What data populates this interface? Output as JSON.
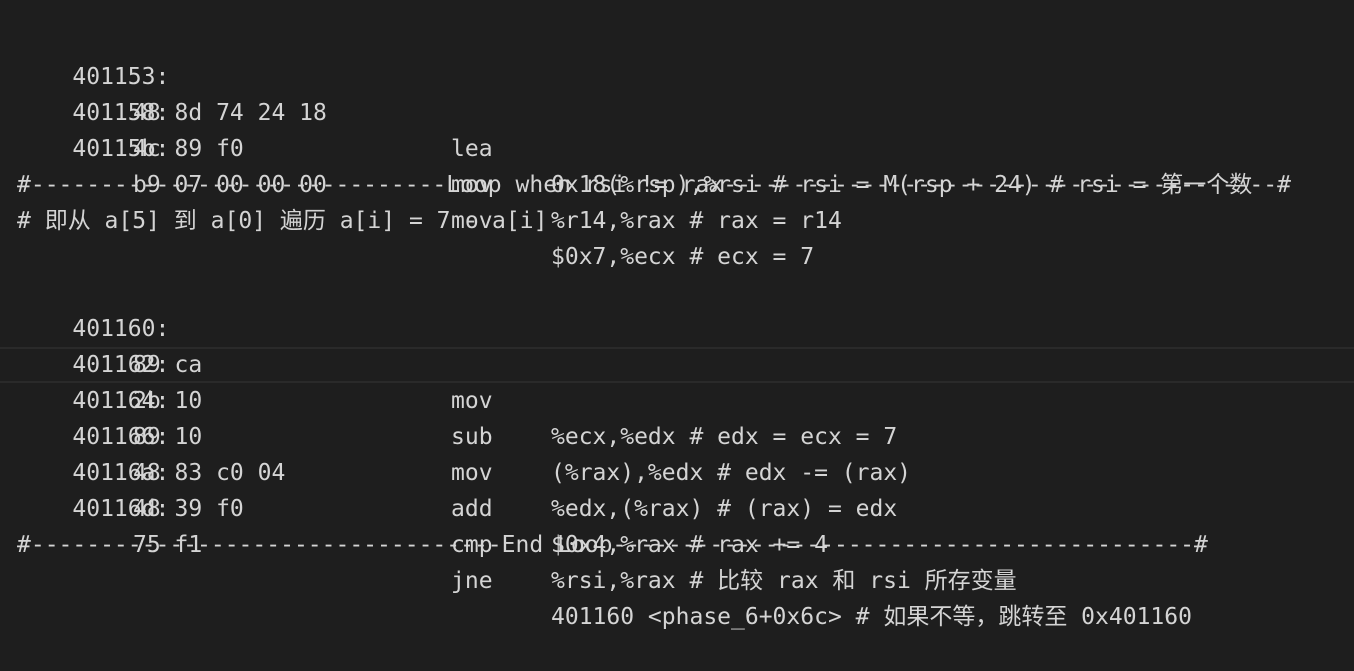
{
  "lines": [
    {
      "addr": "401153:",
      "bytes": "48 8d 74 24 18",
      "mnemonic": "lea",
      "operands": "0x18(%rsp),%rsi # rsi = M(rsp + 24) # rsi = 第一个数"
    },
    {
      "addr": "401158:",
      "bytes": "4c 89 f0",
      "mnemonic": "mov",
      "operands": "%r14,%rax # rax = r14"
    },
    {
      "addr": "40115b:",
      "bytes": "b9 07 00 00 00",
      "mnemonic": "mov",
      "operands": "$0x7,%ecx # ecx = 7"
    }
  ],
  "loop_header": "#------------------------------Loop when rsi != rax----------------------------------------#",
  "loop_comment": "# 即从 a[5] 到 a[0] 遍历 a[i] = 7 - a[i]",
  "loop_lines": [
    {
      "addr": "401160:",
      "bytes": "89 ca",
      "mnemonic": "mov",
      "operands": "%ecx,%edx # edx = ecx = 7"
    },
    {
      "addr": "401162:",
      "bytes": "2b 10",
      "mnemonic": "sub",
      "operands": "(%rax),%edx # edx -= (rax)"
    },
    {
      "addr": "401164:",
      "bytes": "89 10",
      "mnemonic": "mov",
      "operands": "%edx,(%rax) # (rax) = edx"
    },
    {
      "addr": "401166:",
      "bytes": "48 83 c0 04",
      "mnemonic": "add",
      "operands": "$0x4,%rax # rax += 4"
    },
    {
      "addr": "40116a:",
      "bytes": "48 39 f0",
      "mnemonic": "cmp",
      "operands": "%rsi,%rax # 比较 rax 和 rsi 所存变量"
    },
    {
      "addr": "40116d:",
      "bytes": "75 f1",
      "mnemonic": "jne",
      "operands": "401160 <phase_6+0x6c> # 如果不等，跳转至 0x401160"
    }
  ],
  "end_loop": "#----------------------------------End Loop------------------------------------------#"
}
